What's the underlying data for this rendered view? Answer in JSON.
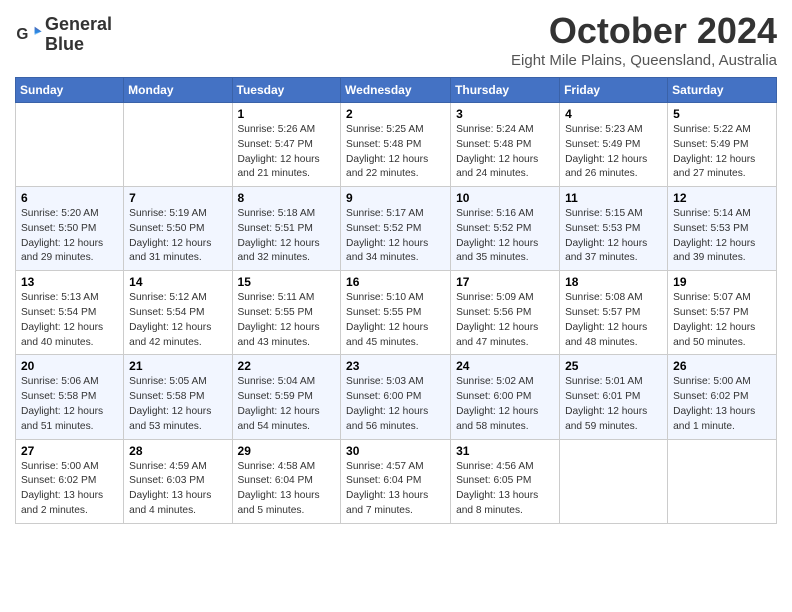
{
  "header": {
    "logo_line1": "General",
    "logo_line2": "Blue",
    "month": "October 2024",
    "location": "Eight Mile Plains, Queensland, Australia"
  },
  "weekdays": [
    "Sunday",
    "Monday",
    "Tuesday",
    "Wednesday",
    "Thursday",
    "Friday",
    "Saturday"
  ],
  "weeks": [
    [
      {
        "day": "",
        "info": ""
      },
      {
        "day": "",
        "info": ""
      },
      {
        "day": "1",
        "info": "Sunrise: 5:26 AM\nSunset: 5:47 PM\nDaylight: 12 hours\nand 21 minutes."
      },
      {
        "day": "2",
        "info": "Sunrise: 5:25 AM\nSunset: 5:48 PM\nDaylight: 12 hours\nand 22 minutes."
      },
      {
        "day": "3",
        "info": "Sunrise: 5:24 AM\nSunset: 5:48 PM\nDaylight: 12 hours\nand 24 minutes."
      },
      {
        "day": "4",
        "info": "Sunrise: 5:23 AM\nSunset: 5:49 PM\nDaylight: 12 hours\nand 26 minutes."
      },
      {
        "day": "5",
        "info": "Sunrise: 5:22 AM\nSunset: 5:49 PM\nDaylight: 12 hours\nand 27 minutes."
      }
    ],
    [
      {
        "day": "6",
        "info": "Sunrise: 5:20 AM\nSunset: 5:50 PM\nDaylight: 12 hours\nand 29 minutes."
      },
      {
        "day": "7",
        "info": "Sunrise: 5:19 AM\nSunset: 5:50 PM\nDaylight: 12 hours\nand 31 minutes."
      },
      {
        "day": "8",
        "info": "Sunrise: 5:18 AM\nSunset: 5:51 PM\nDaylight: 12 hours\nand 32 minutes."
      },
      {
        "day": "9",
        "info": "Sunrise: 5:17 AM\nSunset: 5:52 PM\nDaylight: 12 hours\nand 34 minutes."
      },
      {
        "day": "10",
        "info": "Sunrise: 5:16 AM\nSunset: 5:52 PM\nDaylight: 12 hours\nand 35 minutes."
      },
      {
        "day": "11",
        "info": "Sunrise: 5:15 AM\nSunset: 5:53 PM\nDaylight: 12 hours\nand 37 minutes."
      },
      {
        "day": "12",
        "info": "Sunrise: 5:14 AM\nSunset: 5:53 PM\nDaylight: 12 hours\nand 39 minutes."
      }
    ],
    [
      {
        "day": "13",
        "info": "Sunrise: 5:13 AM\nSunset: 5:54 PM\nDaylight: 12 hours\nand 40 minutes."
      },
      {
        "day": "14",
        "info": "Sunrise: 5:12 AM\nSunset: 5:54 PM\nDaylight: 12 hours\nand 42 minutes."
      },
      {
        "day": "15",
        "info": "Sunrise: 5:11 AM\nSunset: 5:55 PM\nDaylight: 12 hours\nand 43 minutes."
      },
      {
        "day": "16",
        "info": "Sunrise: 5:10 AM\nSunset: 5:55 PM\nDaylight: 12 hours\nand 45 minutes."
      },
      {
        "day": "17",
        "info": "Sunrise: 5:09 AM\nSunset: 5:56 PM\nDaylight: 12 hours\nand 47 minutes."
      },
      {
        "day": "18",
        "info": "Sunrise: 5:08 AM\nSunset: 5:57 PM\nDaylight: 12 hours\nand 48 minutes."
      },
      {
        "day": "19",
        "info": "Sunrise: 5:07 AM\nSunset: 5:57 PM\nDaylight: 12 hours\nand 50 minutes."
      }
    ],
    [
      {
        "day": "20",
        "info": "Sunrise: 5:06 AM\nSunset: 5:58 PM\nDaylight: 12 hours\nand 51 minutes."
      },
      {
        "day": "21",
        "info": "Sunrise: 5:05 AM\nSunset: 5:58 PM\nDaylight: 12 hours\nand 53 minutes."
      },
      {
        "day": "22",
        "info": "Sunrise: 5:04 AM\nSunset: 5:59 PM\nDaylight: 12 hours\nand 54 minutes."
      },
      {
        "day": "23",
        "info": "Sunrise: 5:03 AM\nSunset: 6:00 PM\nDaylight: 12 hours\nand 56 minutes."
      },
      {
        "day": "24",
        "info": "Sunrise: 5:02 AM\nSunset: 6:00 PM\nDaylight: 12 hours\nand 58 minutes."
      },
      {
        "day": "25",
        "info": "Sunrise: 5:01 AM\nSunset: 6:01 PM\nDaylight: 12 hours\nand 59 minutes."
      },
      {
        "day": "26",
        "info": "Sunrise: 5:00 AM\nSunset: 6:02 PM\nDaylight: 13 hours\nand 1 minute."
      }
    ],
    [
      {
        "day": "27",
        "info": "Sunrise: 5:00 AM\nSunset: 6:02 PM\nDaylight: 13 hours\nand 2 minutes."
      },
      {
        "day": "28",
        "info": "Sunrise: 4:59 AM\nSunset: 6:03 PM\nDaylight: 13 hours\nand 4 minutes."
      },
      {
        "day": "29",
        "info": "Sunrise: 4:58 AM\nSunset: 6:04 PM\nDaylight: 13 hours\nand 5 minutes."
      },
      {
        "day": "30",
        "info": "Sunrise: 4:57 AM\nSunset: 6:04 PM\nDaylight: 13 hours\nand 7 minutes."
      },
      {
        "day": "31",
        "info": "Sunrise: 4:56 AM\nSunset: 6:05 PM\nDaylight: 13 hours\nand 8 minutes."
      },
      {
        "day": "",
        "info": ""
      },
      {
        "day": "",
        "info": ""
      }
    ]
  ]
}
